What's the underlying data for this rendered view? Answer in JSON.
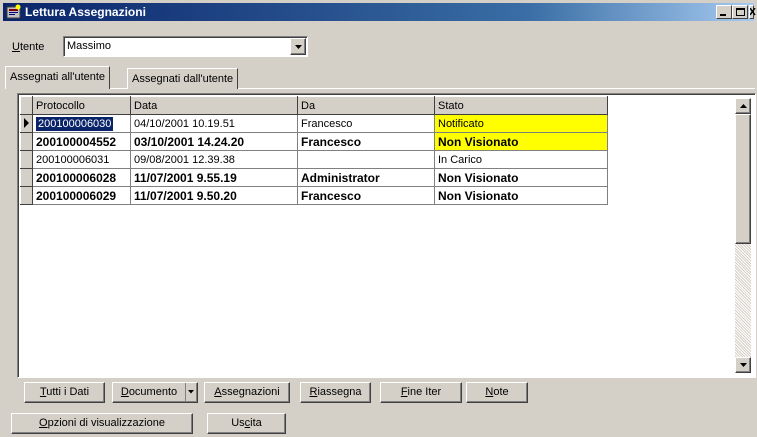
{
  "window": {
    "title": "Lettura Assegnazioni"
  },
  "utente": {
    "label_prefix": "",
    "label_mnemonic": "U",
    "label_rest": "tente",
    "value": "Massimo"
  },
  "tabs": [
    {
      "label": "Assegnati all'utente",
      "active": true
    },
    {
      "label": "Assegnati dall'utente",
      "active": false
    }
  ],
  "grid": {
    "columns": [
      "Protocollo",
      "Data",
      "Da",
      "Stato"
    ],
    "rows": [
      {
        "protocollo": "200100006030",
        "data": "04/10/2001 10.19.51",
        "da": "Francesco",
        "stato": "Notificato",
        "bold": false,
        "highlight": true,
        "current": true
      },
      {
        "protocollo": "200100004552",
        "data": "03/10/2001 14.24.20",
        "da": "Francesco",
        "stato": "Non Visionato",
        "bold": true,
        "highlight": true,
        "current": false
      },
      {
        "protocollo": "200100006031",
        "data": "09/08/2001 12.39.38",
        "da": "",
        "stato": "In Carico",
        "bold": false,
        "highlight": false,
        "current": false
      },
      {
        "protocollo": "200100006028",
        "data": "11/07/2001 9.55.19",
        "da": "Administrator",
        "stato": "Non Visionato",
        "bold": true,
        "highlight": false,
        "current": false
      },
      {
        "protocollo": "200100006029",
        "data": "11/07/2001 9.50.20",
        "da": "Francesco",
        "stato": "Non Visionato",
        "bold": true,
        "highlight": false,
        "current": false
      }
    ],
    "highlight_color": "#ffff00"
  },
  "toolbar": {
    "tutti_i_dati": {
      "mnemonic": "T",
      "rest": "utti i Dati"
    },
    "documento": {
      "mnemonic": "D",
      "rest": "ocumento"
    },
    "assegnazioni": {
      "mnemonic": "A",
      "rest": "ssegnazioni"
    },
    "riassegna": {
      "mnemonic": "R",
      "rest": "iassegna"
    },
    "fine_iter": {
      "mnemonic": "F",
      "rest": "ine Iter"
    },
    "note": {
      "mnemonic": "N",
      "rest": "ote"
    }
  },
  "bottom": {
    "opzioni": {
      "mnemonic": "O",
      "rest": "pzioni di visualizzazione"
    },
    "uscita": {
      "pre": "Us",
      "mnemonic": "c",
      "rest": "ita"
    }
  },
  "colors": {
    "titlebar": "#0a246a",
    "face": "#d4d0c8",
    "selection": "#0a246a"
  },
  "icons": [
    "app-icon",
    "minimize-icon",
    "maximize-icon",
    "close-icon",
    "chevron-down-icon",
    "row-pointer-icon",
    "scroll-up-icon",
    "scroll-down-icon"
  ]
}
